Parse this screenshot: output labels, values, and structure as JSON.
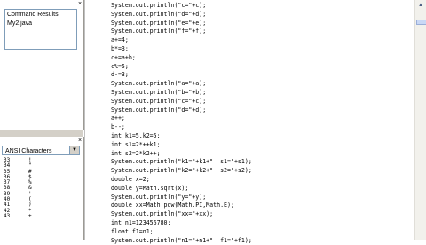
{
  "top_panel": {
    "close_glyph": "×",
    "items": [
      "Command Results",
      "My2.java"
    ]
  },
  "bottom_panel": {
    "close_glyph": "×",
    "charset_select": "ANSI Characters",
    "rows": [
      {
        "code": "33",
        "ch": "!"
      },
      {
        "code": "34",
        "ch": "\""
      },
      {
        "code": "35",
        "ch": "#"
      },
      {
        "code": "36",
        "ch": "$"
      },
      {
        "code": "37",
        "ch": "%"
      },
      {
        "code": "38",
        "ch": "&"
      },
      {
        "code": "39",
        "ch": "'"
      },
      {
        "code": "40",
        "ch": "("
      },
      {
        "code": "41",
        "ch": ")"
      },
      {
        "code": "42",
        "ch": "*"
      },
      {
        "code": "43",
        "ch": "+"
      }
    ]
  },
  "editor": {
    "lines": [
      "System.out.println(\"c=\"+c);",
      "System.out.println(\"d=\"+d);",
      "System.out.println(\"e=\"+e);",
      "System.out.println(\"f=\"+f);",
      "a+=4;",
      "b*=3;",
      "c+=a+b;",
      "c%=5;",
      "d-=3;",
      "System.out.println(\"a=\"+a);",
      "System.out.println(\"b=\"+b);",
      "System.out.println(\"c=\"+c);",
      "System.out.println(\"d=\"+d);",
      "a++;",
      "b--;",
      "int k1=5,k2=5;",
      "int s1=2*++k1;",
      "int s2=2*k2++;",
      "System.out.println(\"k1=\"+k1+\"  s1=\"+s1);",
      "System.out.println(\"k2=\"+k2+\"  s2=\"+s2);",
      "double x=2;",
      "double y=Math.sqrt(x);",
      "System.out.println(\"y=\"+y);",
      "double xx=Math.pow(Math.PI,Math.E);",
      "System.out.println(\"xx=\"+xx);",
      "int n1=123456780;",
      "float f1=n1;",
      "System.out.println(\"n1=\"+n1+\"  f1=\"+f1);"
    ]
  }
}
